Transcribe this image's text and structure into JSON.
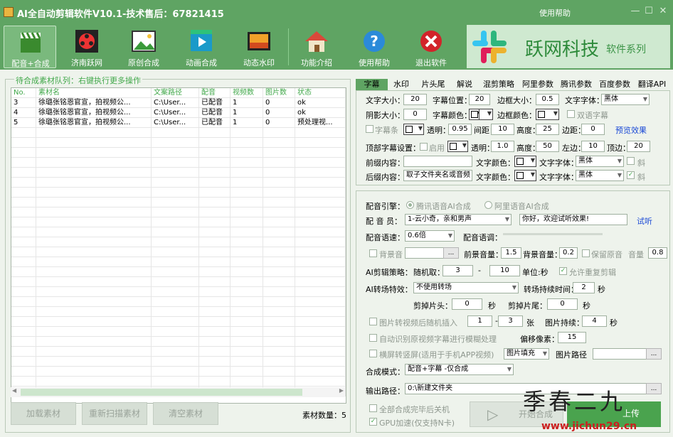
{
  "app": {
    "title": "AI全自动剪辑软件V10.1-技术售后：67821415",
    "help": "使用帮助"
  },
  "toolbar": [
    {
      "label": "配音+合成",
      "icon": "clapperboard-icon",
      "active": true
    },
    {
      "label": "济南跃网",
      "icon": "film-reel-icon"
    },
    {
      "label": "原创合成",
      "icon": "picture-icon"
    },
    {
      "label": "动画合成",
      "icon": "play-video-icon"
    },
    {
      "label": "动态水印",
      "icon": "sunset-image-icon"
    },
    {
      "label": "功能介绍",
      "icon": "home-icon"
    },
    {
      "label": "使用帮助",
      "icon": "help-icon"
    },
    {
      "label": "退出软件",
      "icon": "exit-icon"
    }
  ],
  "logo": {
    "brand": "跃网科技",
    "sub": "软件系列"
  },
  "queue": {
    "caption": "待合成素材队列：右键执行更多操作",
    "columns": [
      "No.",
      "素材名",
      "文案路径",
      "配音",
      "视频数",
      "图片数",
      "状态"
    ],
    "rows": [
      [
        "3",
        "徐璐张铭恩官宣，拍视频公...",
        "C:\\User...",
        "已配音",
        "1",
        "0",
        "ok"
      ],
      [
        "4",
        "徐璐张铭恩官宣，拍视频公...",
        "C:\\User...",
        "已配音",
        "1",
        "0",
        "ok"
      ],
      [
        "5",
        "徐璐张铭恩官宣，拍视频公...",
        "C:\\User...",
        "已配音",
        "1",
        "0",
        "预处理视..."
      ]
    ],
    "buttons": [
      "加载素材",
      "重新扫描素材",
      "清空素材"
    ],
    "count_label": "素材数量：5"
  },
  "tabs": [
    "字幕",
    "水印",
    "片头尾",
    "解说",
    "混剪策略",
    "阿里参数",
    "腾讯参数",
    "百度参数",
    "翻译API"
  ],
  "subtitle": {
    "font_size_label": "文字大小：",
    "font_size": "20",
    "pos_label": "字幕位置：",
    "pos": "20",
    "border_size_label": "边框大小：",
    "border_size": "0.5",
    "font_label": "文字字体：",
    "font": "黑体",
    "shadow_label": "阴影大小：",
    "shadow": "0",
    "color_label": "字幕颜色：",
    "border_color_label": "边框颜色：",
    "bilingual_label": "双语字幕",
    "bar_label": "字幕条",
    "alpha_label": "透明：",
    "alpha": "0.95",
    "spacing_label": "间距：",
    "spacing": "10",
    "height_label": "高度：",
    "height": "25",
    "margin_label": "边距：",
    "margin": "0",
    "preview": "预览效果",
    "top_label": "顶部字幕设置：",
    "enable_label": "启用",
    "top_alpha_label": "透明：",
    "top_alpha": "1.0",
    "top_height_label": "高度：",
    "top_height": "50",
    "left_margin_label": "左边：",
    "left_margin": "10",
    "top_margin_label": "顶边：",
    "top_margin": "20",
    "prefix_label": "前缀内容：",
    "prefix": "",
    "suffix_label": "后缀内容：",
    "suffix": "取子文件夹名或音频",
    "text_color_label": "文字颜色：",
    "text_font_label": "文字字体：",
    "text_font": "黑体",
    "italic_label": "斜"
  },
  "dub": {
    "engine_label": "配音引擎：",
    "engine_tencent": "腾讯语音AI合成",
    "engine_ali": "阿里语音AI合成",
    "voice_label": "配 音 员：",
    "voice": "1-云小奇，亲和男声",
    "sample_text": "你好，欢迎试听效果!",
    "listen": "试听",
    "speed_label": "配音语速：",
    "speed": "0.6倍",
    "pitch_label": "配音语调：",
    "bgm_label": "背景音",
    "fg_vol_label": "前景音量：",
    "fg_vol": "1.5",
    "bg_vol_label": "背景音量：",
    "bg_vol": "0.2",
    "keep_orig_label": "保留原音",
    "orig_vol_label": "音量",
    "orig_vol": "0.8",
    "strategy_label": "AI剪辑策略：",
    "random_label": "随机取：",
    "random_min": "3",
    "dash": "-",
    "random_max": "10",
    "unit_label": "单位:秒",
    "repeat_label": "允许重复剪辑",
    "transition_label": "AI转场特效：",
    "transition": "不使用转场",
    "transition_dur_label": "转场持续时间：",
    "transition_dur": "2",
    "sec": "秒",
    "cut_head_label": "剪掉片头：",
    "cut_head": "0",
    "cut_tail_label": "剪掉片尾：",
    "cut_tail": "0",
    "img_insert_label": "图片转视频后随机插入",
    "img_min": "1",
    "img_max": "3",
    "img_unit": "张",
    "img_dur_label": "图片持续：",
    "img_dur": "4",
    "blur_label": "自动识别原视频字幕进行模糊处理",
    "offset_label": "偏移像素：",
    "offset": "15",
    "portrait_label": "横屏转竖屏(适用于手机APP视频)",
    "fill_mode": "图片填充",
    "img_path_label": "图片路径",
    "mode_label": "合成模式：",
    "mode": "配音+字幕 -仅合成",
    "output_label": "输出路径：",
    "output": "0:\\新建文件夹",
    "shutdown_label": "全部合成完毕后关机",
    "gpu_label": "GPU加速(仅支持N卡)",
    "start_label": "开始合成",
    "upload_label": "上传"
  },
  "watermark": {
    "text": "季春二九",
    "url": "www.jichun29.cn"
  },
  "colors": {
    "accent": "#5fa463",
    "green_text": "#41a84a",
    "link": "#1a49d6"
  }
}
